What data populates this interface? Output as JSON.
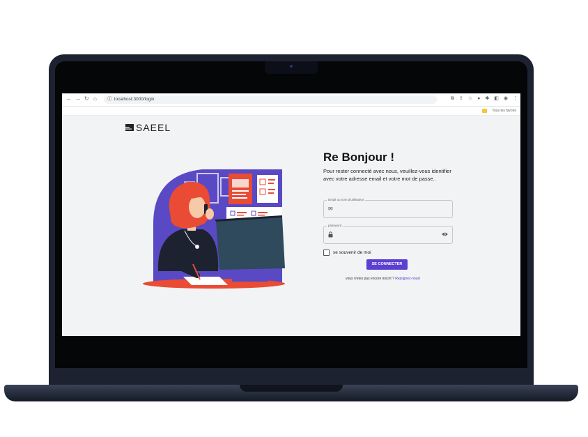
{
  "browser": {
    "url": "localhost:3000/login",
    "bookmarks_label": "Tous les favoris"
  },
  "brand": {
    "logo_text": "SAEEL"
  },
  "login": {
    "title": "Re Bonjour !",
    "subtitle": "Pour rester connecté avec nous, veuillez-vous identifier avec votre adresse email et votre mot de passe..",
    "email_label": "Email ou nom d'utilisateur",
    "password_label": "password",
    "remember_label": "se souvenir de moi",
    "submit_label": "SE CONNECTER",
    "signup_prompt": "vous n'etes pas encore inscrit ?",
    "signup_link": "Rejoignez-nous!"
  },
  "icons": {
    "back": "arrow-left-icon",
    "forward": "arrow-right-icon",
    "reload": "reload-icon",
    "home": "home-icon",
    "site_info": "site-info-icon",
    "email": "mail-icon",
    "password": "lock-icon",
    "toggle_visibility": "eye-icon"
  },
  "colors": {
    "primary": "#5b3fd1",
    "illustration_purple": "#5a49c4",
    "accent_red": "#e94b34",
    "page_background": "#f1f3f4"
  }
}
